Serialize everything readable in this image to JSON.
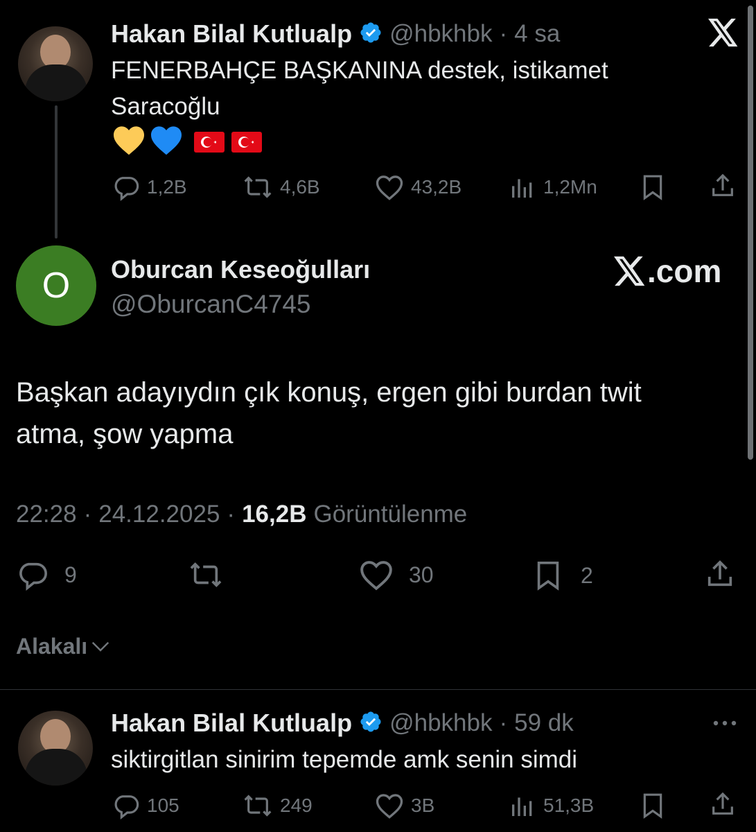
{
  "quoted_tweet": {
    "author_name": "Hakan Bilal Kutlualp",
    "handle": "@hbkhbk",
    "separator": "·",
    "time": "4 sa",
    "text_line1": "FENERBAHÇE BAŞKANINA destek, istikamet",
    "text_line2": "Saracoğlu",
    "emojis": [
      "yellow-heart",
      "blue-heart",
      "turkey-flag",
      "turkey-flag"
    ],
    "stats": {
      "replies": "1,2B",
      "retweets": "4,6B",
      "likes": "43,2B",
      "views": "1,2Mn"
    }
  },
  "main_tweet": {
    "avatar_letter": "O",
    "avatar_color": "#3b7d23",
    "author_name": "Oburcan Keseoğulları",
    "handle": "@OburcanC4745",
    "watermark": "X.com",
    "text_line1": "Başkan adayıydın çık konuş, ergen gibi burdan twit",
    "text_line2": "atma, şow yapma",
    "time": "22:28",
    "sep1": "·",
    "date": "24.12.2025",
    "sep2": "·",
    "views_count": "16,2B",
    "views_label": "Görüntülenme",
    "stats": {
      "replies": "9",
      "likes": "30",
      "bookmarks": "2"
    }
  },
  "sort": {
    "label": "Alakalı"
  },
  "reply_tweet": {
    "author_name": "Hakan Bilal Kutlualp",
    "handle": "@hbkhbk",
    "separator": "·",
    "time": "59 dk",
    "text": "siktirgitlan sinirim tepemde amk senin simdi",
    "stats": {
      "replies": "105",
      "retweets": "249",
      "likes": "3B",
      "views": "51,3B"
    }
  },
  "colors": {
    "background": "#000000",
    "text": "#e7e9ea",
    "muted": "#71767b",
    "verified": "#1d9bf0"
  }
}
